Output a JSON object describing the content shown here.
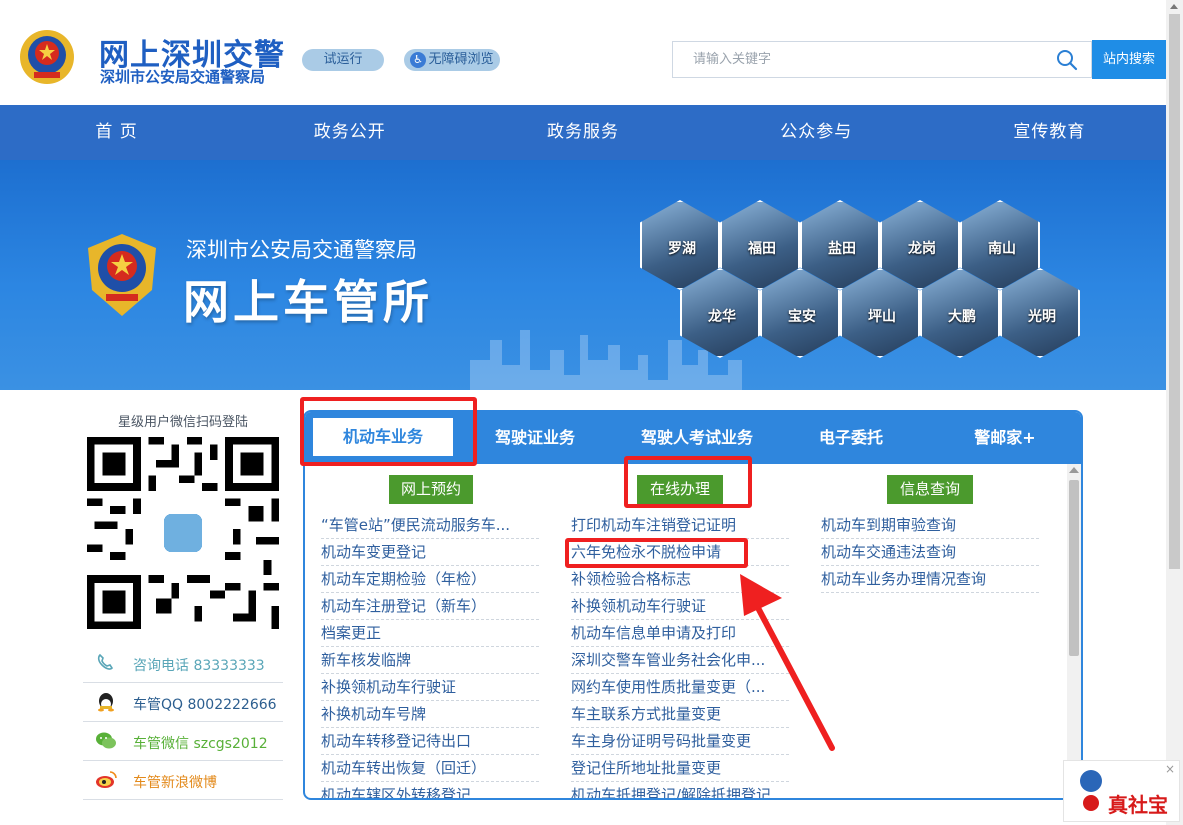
{
  "header": {
    "title": "网上深圳交警",
    "subtitle": "深圳市公安局交通警察局",
    "trial_badge": "试运行",
    "accessibility_badge": "无障碍浏览",
    "search_placeholder": "请输入关键字",
    "search_button": "站内搜索"
  },
  "nav": {
    "items": [
      "首 页",
      "政务公开",
      "政务服务",
      "公众参与",
      "宣传教育"
    ]
  },
  "banner": {
    "subtitle": "深圳市公安局交通警察局",
    "title": "网上车管所",
    "stations": [
      "罗湖",
      "福田",
      "盐田",
      "龙岗",
      "南山",
      "龙华",
      "宝安",
      "坪山",
      "大鹏",
      "光明"
    ]
  },
  "sidebar": {
    "qr_title": "星级用户微信扫码登陆",
    "contacts": [
      {
        "icon": "phone-icon",
        "text": "咨询电话 83333333"
      },
      {
        "icon": "qq-icon",
        "text": "车管QQ 8002222666"
      },
      {
        "icon": "wechat-icon",
        "text": "车管微信 szcgs2012"
      },
      {
        "icon": "weibo-icon",
        "text": "车管新浪微博"
      }
    ]
  },
  "services": {
    "tabs": [
      "机动车业务",
      "驾驶证业务",
      "驾驶人考试业务",
      "电子委托",
      "警邮家+"
    ],
    "active_tab": "机动车业务",
    "columns": [
      {
        "heading": "网上预约",
        "items": [
          "“车管e站”便民流动服务车...",
          "机动车变更登记",
          "机动车定期检验（年检）",
          "机动车注册登记（新车）",
          "档案更正",
          "新车核发临牌",
          "补换领机动车行驶证",
          "补换机动车号牌",
          "机动车转移登记待出口",
          "机动车转出恢复（回迁）",
          "机动车辖区外转移登记"
        ]
      },
      {
        "heading": "在线办理",
        "items": [
          "打印机动车注销登记证明",
          "六年免检永不脱检申请",
          "补领检验合格标志",
          "补换领机动车行驶证",
          "机动车信息单申请及打印",
          "深圳交警车管业务社会化申...",
          "网约车使用性质批量变更（...",
          "车主联系方式批量变更",
          "车主身份证明号码批量变更",
          "登记住所地址批量变更",
          "机动车抵押登记/解除抵押登记"
        ]
      },
      {
        "heading": "信息查询",
        "items": [
          "机动车到期审验查询",
          "机动车交通违法查询",
          "机动车业务办理情况查询"
        ]
      }
    ]
  },
  "watermark": {
    "text": "真社宝",
    "close": "×"
  },
  "colors": {
    "brand_blue": "#1f5fc2",
    "nav_blue": "#2d6cc6",
    "panel_blue": "#2f86dd",
    "column_green": "#4b9a2d",
    "annotation_red": "#ef2020"
  }
}
